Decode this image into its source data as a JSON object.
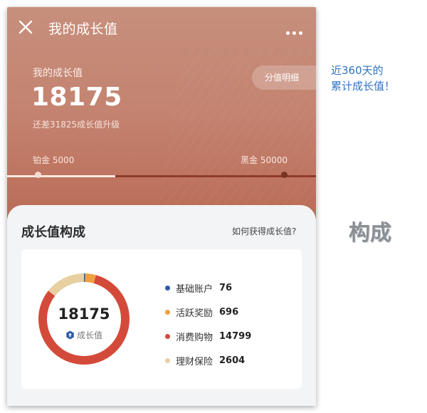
{
  "header": {
    "title": "我的成长值"
  },
  "summary": {
    "label": "我的成长值",
    "value": "18175",
    "gap_text": "还差31825成长值升级",
    "detail_button": "分值明细",
    "progress_fraction": 0.35
  },
  "tiers": {
    "current": "铂金  5000",
    "next": "黑金  50000"
  },
  "composition": {
    "title": "成长值构成",
    "help_link": "如何获得成长值?",
    "total": "18175",
    "total_label": "成长值",
    "items": [
      {
        "name": "基础账户",
        "value": "76",
        "color": "#2f5aa8"
      },
      {
        "name": "活跃奖励",
        "value": "696",
        "color": "#f0a040"
      },
      {
        "name": "消费购物",
        "value": "14799",
        "color": "#d44a3a"
      },
      {
        "name": "理财保险",
        "value": "2604",
        "color": "#e8cfa0"
      }
    ]
  },
  "annotations": {
    "note_line1": "近360天的",
    "note_line2": "累计成长值！",
    "section_label": "构成"
  }
}
